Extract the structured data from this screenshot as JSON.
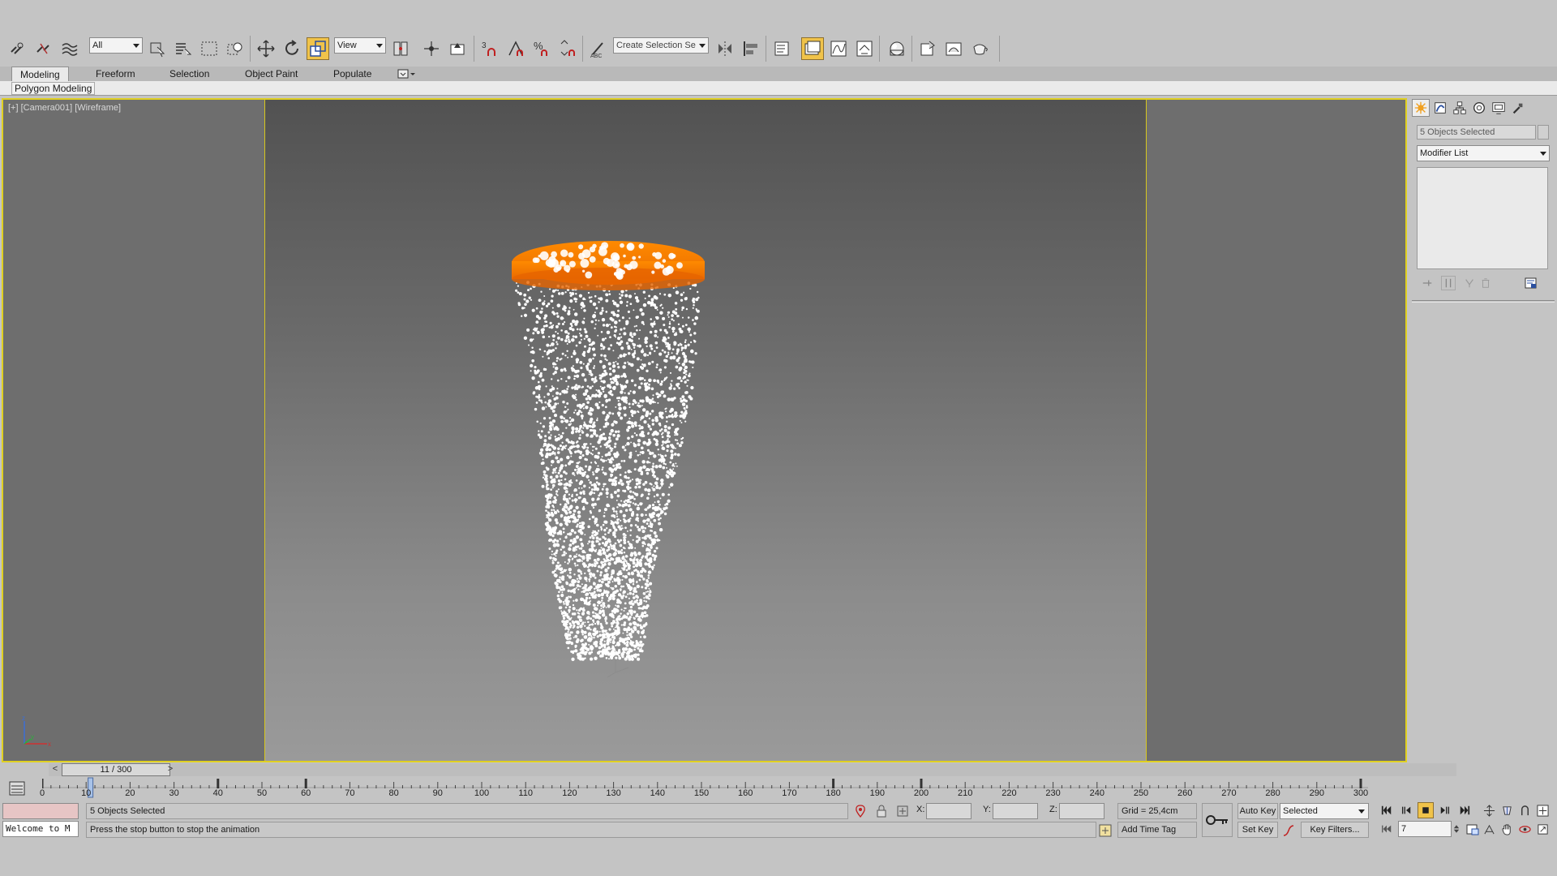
{
  "toolbar": {
    "selection_filter": "All",
    "ref_coord_system": "View",
    "snap_angle_label": "3",
    "percent_snap_label": "%",
    "named_selection": "Create Selection Se"
  },
  "ribbon": {
    "tabs": [
      "Modeling",
      "Freeform",
      "Selection",
      "Object Paint",
      "Populate"
    ],
    "active_tab": "Modeling",
    "group_label": "Polygon Modeling"
  },
  "viewport": {
    "label": "[+] [Camera001] [Wireframe]",
    "object_colors": {
      "emitter_top": "#ff8a00",
      "emitter_bottom": "#e86a00",
      "particles": "#ffffff"
    }
  },
  "command_panel": {
    "tabs": [
      "create-icon",
      "modify-icon",
      "hierarchy-icon",
      "motion-icon",
      "display-icon",
      "utilities-icon"
    ],
    "active_tab": "create-icon",
    "name_field": "5 Objects Selected",
    "modifier_list": "Modifier List"
  },
  "time_slider": {
    "readout": "11 / 300",
    "prev": "<",
    "next": ">",
    "current_frame": 11,
    "total_frames": 300
  },
  "track_bar": {
    "ticks": [
      0,
      10,
      20,
      30,
      40,
      50,
      60,
      70,
      80,
      90,
      100,
      110,
      120,
      130,
      140,
      150,
      160,
      170,
      180,
      190,
      200,
      210,
      220,
      230,
      240,
      250,
      260,
      270,
      280,
      290,
      300
    ],
    "key_frames": [
      0,
      40,
      60,
      180,
      200,
      300
    ]
  },
  "status": {
    "listener_text": "Welcome to M",
    "selection": "5 Objects Selected",
    "prompt": "Press the stop button to stop the animation",
    "x_label": "X:",
    "y_label": "Y:",
    "z_label": "Z:",
    "grid": "Grid = 25,4cm",
    "add_time_tag": "Add Time Tag",
    "auto_key": "Auto Key",
    "set_key": "Set Key",
    "key_mode": "Selected",
    "key_filters": "Key Filters...",
    "frame_field": "7"
  }
}
